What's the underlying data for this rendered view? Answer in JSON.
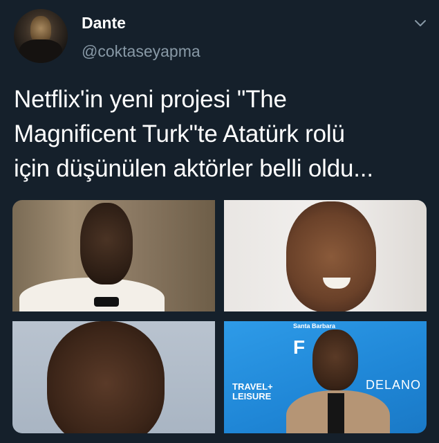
{
  "user": {
    "display_name": "Dante",
    "handle": "@coktaseyapma"
  },
  "tweet": {
    "lines": [
      "Netflix'in yeni projesi \"The",
      "Magnificent Turk\"te Atatürk rolü",
      "için düşünülen aktörler belli oldu..."
    ]
  },
  "photos": {
    "p4_logos": {
      "travel": "TRAVEL+",
      "leisure": "LEISURE",
      "delano": "DELANO",
      "santa_barbara": "Santa Barbara",
      "festival_letter": "F"
    }
  },
  "icons": {
    "menu": "chevron-down-icon"
  },
  "colors": {
    "background": "#15202b",
    "secondary_text": "#8899a6"
  }
}
